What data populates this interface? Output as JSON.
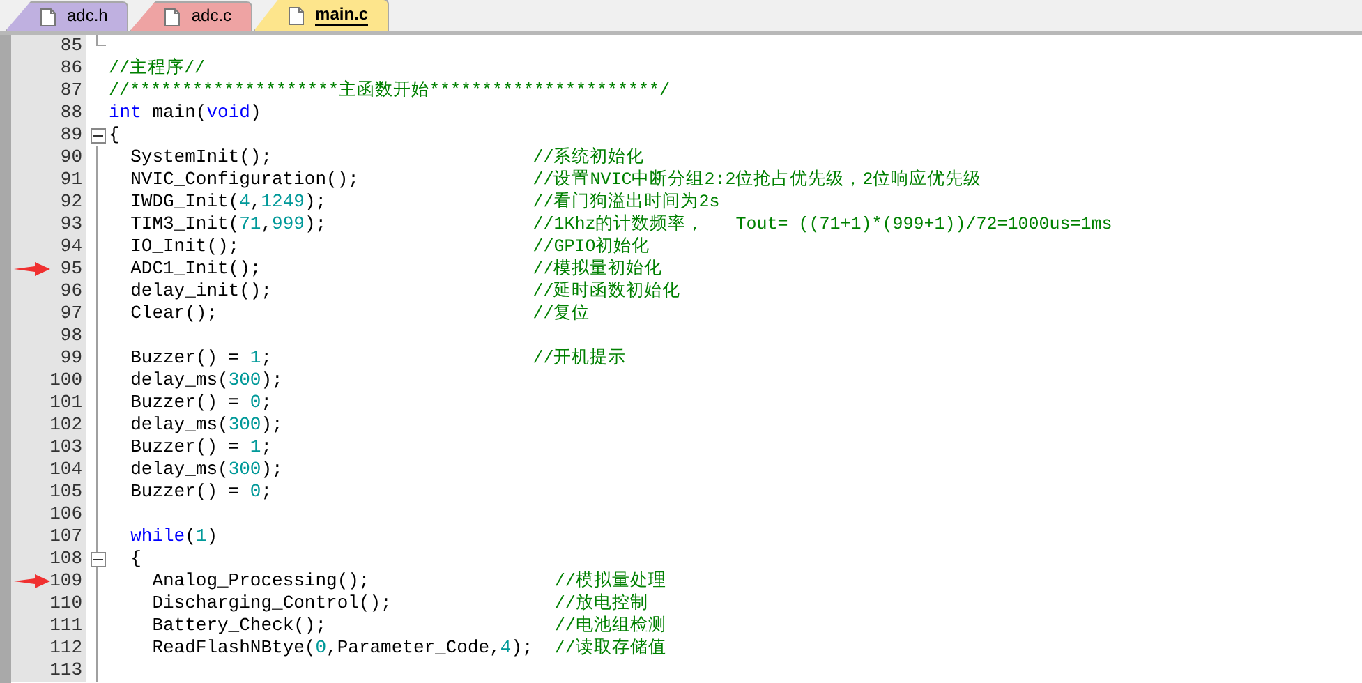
{
  "tabs": [
    {
      "label": "adc.h",
      "selected": false,
      "color": "#bfb0e0"
    },
    {
      "label": "adc.c",
      "selected": false,
      "color": "#eea3a3"
    },
    {
      "label": "main.c",
      "selected": true,
      "color": "#fde58c"
    }
  ],
  "lines": [
    {
      "number": "85",
      "kind": "closer",
      "marked": false
    },
    {
      "number": "86",
      "marked": false,
      "comment": "//主程序//"
    },
    {
      "number": "87",
      "marked": false,
      "comment": "//********************主函数开始**********************/"
    },
    {
      "number": "88",
      "marked": false,
      "code": [
        {
          "kind": "keyword",
          "text": "int"
        },
        {
          "kind": "plain",
          "text": " main("
        },
        {
          "kind": "keyword",
          "text": "void"
        },
        {
          "kind": "plain",
          "text": ")"
        }
      ]
    },
    {
      "number": "89",
      "marked": false,
      "kind": "opener",
      "expanded": true,
      "code": [
        {
          "kind": "plain",
          "text": "{"
        }
      ],
      "children": [
        {
          "number": "90",
          "marked": false,
          "code": [
            {
              "kind": "plain",
              "text": "SystemInit();"
            }
          ],
          "comment": "//系统初始化"
        },
        {
          "number": "91",
          "marked": false,
          "code": [
            {
              "kind": "plain",
              "text": "NVIC_Configuration();"
            }
          ],
          "comment": "//设置NVIC中断分组2:2位抢占优先级，2位响应优先级"
        },
        {
          "number": "92",
          "marked": false,
          "code": [
            {
              "kind": "plain",
              "text": "IWDG_Init("
            },
            {
              "kind": "number",
              "text": "4"
            },
            {
              "kind": "plain",
              "text": ","
            },
            {
              "kind": "number",
              "text": "1249"
            },
            {
              "kind": "plain",
              "text": ");"
            }
          ],
          "comment": "//看门狗溢出时间为2s"
        },
        {
          "number": "93",
          "marked": false,
          "code": [
            {
              "kind": "plain",
              "text": "TIM3_Init("
            },
            {
              "kind": "number",
              "text": "71"
            },
            {
              "kind": "plain",
              "text": ","
            },
            {
              "kind": "number",
              "text": "999"
            },
            {
              "kind": "plain",
              "text": ");"
            }
          ],
          "comment": "//1Khz的计数频率，   Tout= ((71+1)*(999+1))/72=1000us=1ms"
        },
        {
          "number": "94",
          "marked": false,
          "code": [
            {
              "kind": "plain",
              "text": "IO_Init();"
            }
          ],
          "comment": "//GPIO初始化"
        },
        {
          "number": "95",
          "marked": true,
          "code": [
            {
              "kind": "plain",
              "text": "ADC1_Init();"
            }
          ],
          "comment": "//模拟量初始化"
        },
        {
          "number": "96",
          "marked": false,
          "code": [
            {
              "kind": "plain",
              "text": "delay_init();"
            }
          ],
          "comment": "//延时函数初始化"
        },
        {
          "number": "97",
          "marked": false,
          "code": [
            {
              "kind": "plain",
              "text": "Clear();"
            }
          ],
          "comment": "//复位"
        },
        {
          "number": "98",
          "marked": false
        },
        {
          "number": "99",
          "marked": false,
          "code": [
            {
              "kind": "plain",
              "text": "Buzzer() = "
            },
            {
              "kind": "number",
              "text": "1"
            },
            {
              "kind": "plain",
              "text": ";"
            }
          ],
          "comment": "//开机提示"
        },
        {
          "number": "100",
          "marked": false,
          "code": [
            {
              "kind": "plain",
              "text": "delay_ms("
            },
            {
              "kind": "number",
              "text": "300"
            },
            {
              "kind": "plain",
              "text": ");"
            }
          ]
        },
        {
          "number": "101",
          "marked": false,
          "code": [
            {
              "kind": "plain",
              "text": "Buzzer() = "
            },
            {
              "kind": "number",
              "text": "0"
            },
            {
              "kind": "plain",
              "text": ";"
            }
          ]
        },
        {
          "number": "102",
          "marked": false,
          "code": [
            {
              "kind": "plain",
              "text": "delay_ms("
            },
            {
              "kind": "number",
              "text": "300"
            },
            {
              "kind": "plain",
              "text": ");"
            }
          ]
        },
        {
          "number": "103",
          "marked": false,
          "code": [
            {
              "kind": "plain",
              "text": "Buzzer() = "
            },
            {
              "kind": "number",
              "text": "1"
            },
            {
              "kind": "plain",
              "text": ";"
            }
          ]
        },
        {
          "number": "104",
          "marked": false,
          "code": [
            {
              "kind": "plain",
              "text": "delay_ms("
            },
            {
              "kind": "number",
              "text": "300"
            },
            {
              "kind": "plain",
              "text": ");"
            }
          ]
        },
        {
          "number": "105",
          "marked": false,
          "code": [
            {
              "kind": "plain",
              "text": "Buzzer() = "
            },
            {
              "kind": "number",
              "text": "0"
            },
            {
              "kind": "plain",
              "text": ";"
            }
          ]
        },
        {
          "number": "106",
          "marked": false
        },
        {
          "number": "107",
          "marked": false,
          "code": [
            {
              "kind": "keyword",
              "text": "while"
            },
            {
              "kind": "plain",
              "text": "("
            },
            {
              "kind": "number",
              "text": "1"
            },
            {
              "kind": "plain",
              "text": ")"
            }
          ]
        },
        {
          "number": "108",
          "marked": false,
          "kind": "opener",
          "expanded": true,
          "code": [
            {
              "kind": "plain",
              "text": "{"
            }
          ],
          "children": [
            {
              "number": "109",
              "marked": true,
              "code": [
                {
                  "kind": "plain",
                  "text": "Analog_Processing();"
                }
              ],
              "comment": "//模拟量处理"
            },
            {
              "number": "110",
              "marked": false,
              "code": [
                {
                  "kind": "plain",
                  "text": "Discharging_Control();"
                }
              ],
              "comment": "//放电控制"
            },
            {
              "number": "111",
              "marked": false,
              "code": [
                {
                  "kind": "plain",
                  "text": "Battery_Check();"
                }
              ],
              "comment": "//电池组检测"
            },
            {
              "number": "112",
              "marked": false,
              "code": [
                {
                  "kind": "plain",
                  "text": "ReadFlashNBtye("
                },
                {
                  "kind": "number",
                  "text": "0"
                },
                {
                  "kind": "plain",
                  "text": ",Parameter_Code,"
                },
                {
                  "kind": "number",
                  "text": "4"
                },
                {
                  "kind": "plain",
                  "text": ");"
                }
              ],
              "comment": "//读取存储值"
            }
          ]
        },
        {
          "number": "113",
          "marked": false
        }
      ]
    }
  ]
}
